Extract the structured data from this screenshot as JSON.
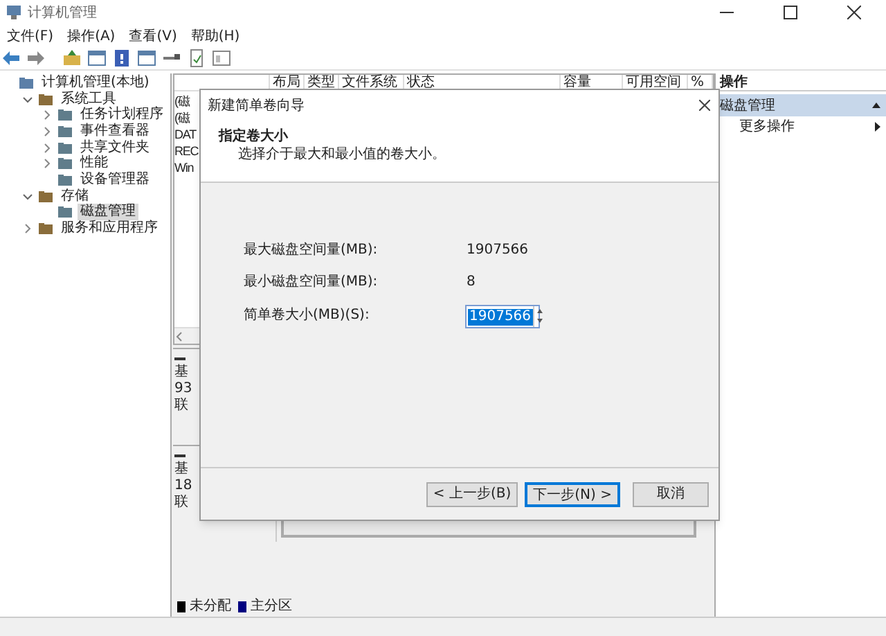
{
  "window": {
    "title": "计算机管理"
  },
  "menu": [
    "文件(F)",
    "操作(A)",
    "查看(V)",
    "帮助(H)"
  ],
  "tree": [
    {
      "label": "计算机管理(本地)",
      "selected": false,
      "children": [
        {
          "label": "系统工具",
          "expanded": true,
          "selected": false,
          "children": [
            {
              "label": "任务计划程序",
              "expanded": false,
              "selected": false
            },
            {
              "label": "事件查看器",
              "expanded": false,
              "selected": false
            },
            {
              "label": "共享文件夹",
              "expanded": false,
              "selected": false
            },
            {
              "label": "性能",
              "expanded": false,
              "selected": false
            },
            {
              "label": "设备管理器",
              "selected": false
            }
          ]
        },
        {
          "label": "存储",
          "expanded": true,
          "selected": false,
          "children": [
            {
              "label": "磁盘管理",
              "selected": true
            }
          ]
        },
        {
          "label": "服务和应用程序",
          "expanded": false,
          "selected": false
        }
      ]
    }
  ],
  "volume_table": {
    "columns": [
      "布局",
      "类型",
      "文件系统",
      "状态",
      "容量",
      "可用空间",
      "%"
    ],
    "rows": [
      "(磁",
      "(磁",
      "DAT",
      "REC",
      "Win"
    ]
  },
  "disks": [
    {
      "lines": [
        "基",
        "93",
        "联"
      ]
    },
    {
      "lines": [
        "基",
        "18",
        "联"
      ]
    }
  ],
  "legend": [
    {
      "label": "未分配",
      "color": "#000000"
    },
    {
      "label": "主分区",
      "color": "#000080"
    }
  ],
  "actions": {
    "header": "操作",
    "section": "磁盘管理",
    "items": [
      "更多操作"
    ]
  },
  "dialog": {
    "title": "新建简单卷向导",
    "heading": "指定卷大小",
    "subheading": "选择介于最大和最小值的卷大小。",
    "rows": [
      {
        "label": "最大磁盘空间量(MB):",
        "value": "1907566"
      },
      {
        "label": "最小磁盘空间量(MB):",
        "value": "8"
      }
    ],
    "size_field": {
      "label": "简单卷大小(MB)(S):",
      "value": "1907566",
      "selected": true
    },
    "buttons": [
      {
        "label": "< 上一步(B)",
        "default": false
      },
      {
        "label": "下一步(N) >",
        "default": true
      },
      {
        "label": "取消",
        "default": false
      }
    ]
  }
}
